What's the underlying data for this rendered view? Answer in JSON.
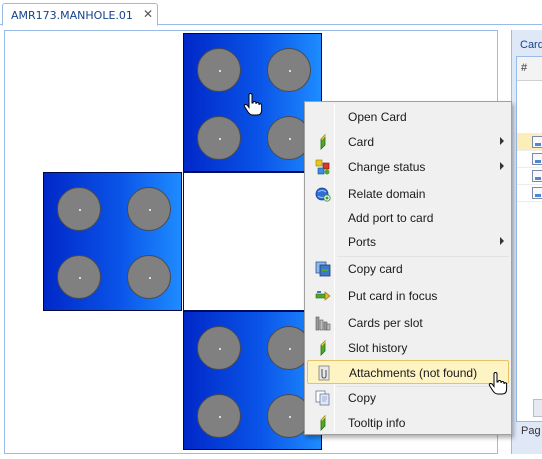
{
  "tab": {
    "title": "AMR173.MANHOLE.01",
    "close_glyph": "✕"
  },
  "side_panel": {
    "title": "Card",
    "grid_header": "#",
    "footer_label": "Pag"
  },
  "context_menu": {
    "items": [
      {
        "label": "Open Card",
        "icon": "none",
        "submenu": false
      },
      {
        "label": "Card",
        "icon": "card-green-bar-icon",
        "submenu": true
      },
      {
        "label": "Change status",
        "icon": "change-status-icon",
        "submenu": true
      },
      {
        "label": "Relate domain",
        "icon": "relate-domain-icon",
        "submenu": false
      },
      {
        "label": "Add port to card",
        "icon": "none",
        "submenu": false
      },
      {
        "label": "Ports",
        "icon": "none",
        "submenu": true
      },
      {
        "label": "Copy card",
        "icon": "copy-card-icon",
        "submenu": false
      },
      {
        "label": "Put card in focus",
        "icon": "focus-icon",
        "submenu": false
      },
      {
        "label": "Cards per slot",
        "icon": "slots-icon",
        "submenu": false
      },
      {
        "label": "Slot history",
        "icon": "history-green-bar-icon",
        "submenu": false
      },
      {
        "label": "Attachments (not found)",
        "icon": "attachment-icon",
        "submenu": false,
        "highlighted": true
      },
      {
        "label": "Copy",
        "icon": "copy-icon",
        "submenu": false
      },
      {
        "label": "Tooltip info",
        "icon": "tooltip-green-bar-icon",
        "submenu": false
      }
    ]
  },
  "colors": {
    "block_dark": "#0028c8",
    "block_light": "#1e8cff",
    "slot_grey": "#808080",
    "highlight": "#fdf3c3",
    "tab_text": "#15428b"
  }
}
